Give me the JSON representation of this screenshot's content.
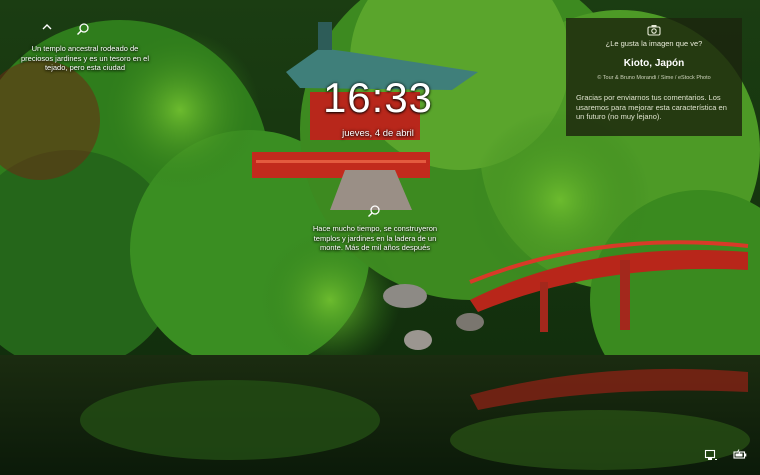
{
  "lockscreen": {
    "time": "16:33",
    "date": "jueves, 4 de abril",
    "left_caption": "Un templo ancestral rodeado de preciosos jardines y es un tesoro en el tejado, pero esta ciudad",
    "mid_caption": "Hace mucho tiempo, se construyeron templos y jardines en la ladera de un monte. Más de mil años después",
    "card": {
      "question": "¿Le gusta la imagen que ve?",
      "title": "Kioto, Japón",
      "credit": "© Tour & Bruno Morandi / Sime / eStock Photo",
      "thanks": "Gracias por enviarnos tus comentarios. Los usaremos para mejorar esta característica en un futuro (no muy lejano)."
    }
  },
  "icons": {
    "top_left": "chevron-icon",
    "search": "search-icon",
    "camera": "camera-icon",
    "network": "network-icon",
    "battery": "battery-icon"
  }
}
